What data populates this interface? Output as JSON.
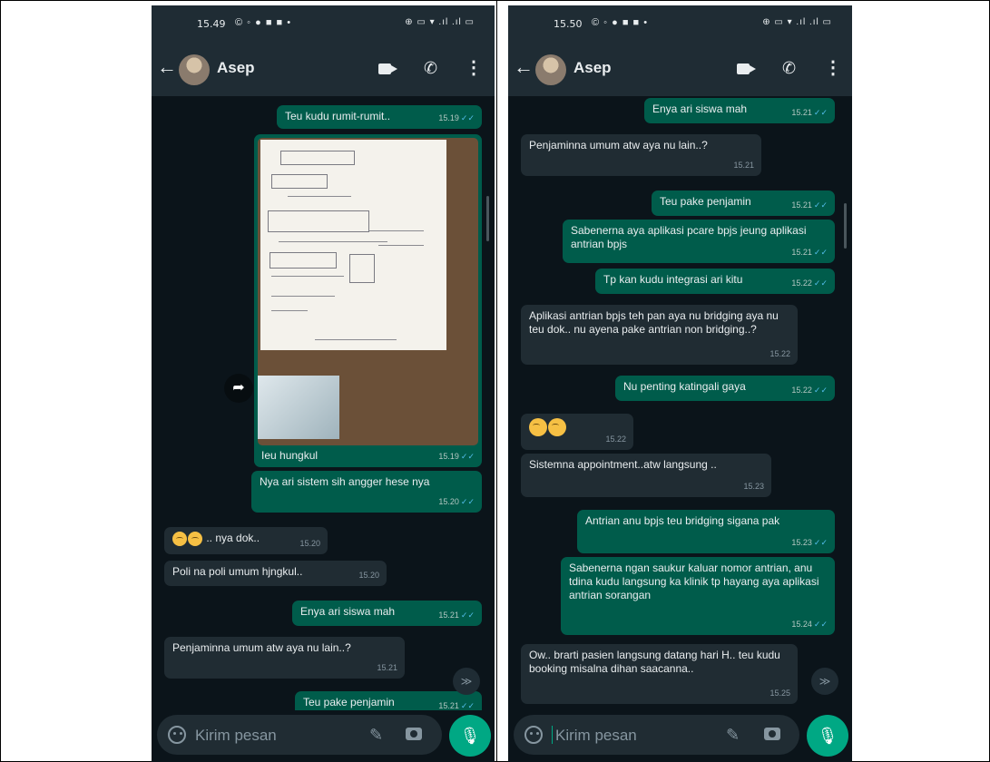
{
  "left": {
    "status": {
      "time": "15.49",
      "notif_icons": "© ◦ ● ■ ■ •",
      "sys_icons": "⊕ ▭ ▾ .ıl .ıl ▭"
    },
    "appbar": {
      "name": "Asep",
      "back": "←",
      "phone": "✆",
      "menu": "⋮"
    },
    "messages": [
      {
        "text": "Teu kudu rumit-rumit..",
        "time": "15.19",
        "tick": "✓✓"
      },
      {
        "caption": "Ieu hungkul",
        "time": "15.19",
        "tick": "✓✓"
      },
      {
        "text": "Nya ari sistem sih angger hese nya",
        "time": "15.20",
        "tick": "✓✓"
      },
      {
        "text": ".. nya dok..",
        "time": "15.20"
      },
      {
        "text": "Poli na poli umum hjngkul..",
        "time": "15.20"
      },
      {
        "text": "Enya ari siswa mah",
        "time": "15.21",
        "tick": "✓✓"
      },
      {
        "text": "Penjaminna umum atw aya nu lain..?",
        "time": "15.21"
      },
      {
        "text": "Teu pake penjamin",
        "time": "15.21",
        "tick": "✓✓"
      }
    ],
    "forward": "➦",
    "scroll_down": "≫",
    "input_placeholder": "Kirim pesan",
    "attach": "✎",
    "mic": "🎙"
  },
  "right": {
    "status": {
      "time": "15.50",
      "notif_icons": "© ◦ ● ■ ■ •",
      "sys_icons": "⊕ ▭ ▾ .ıl .ıl ▭"
    },
    "appbar": {
      "name": "Asep",
      "back": "←",
      "phone": "✆",
      "menu": "⋮"
    },
    "messages": [
      {
        "text": "Enya ari siswa mah",
        "time": "15.21",
        "tick": "✓✓"
      },
      {
        "text": "Penjaminna umum atw aya nu lain..?",
        "time": "15.21"
      },
      {
        "text": "Teu pake penjamin",
        "time": "15.21",
        "tick": "✓✓"
      },
      {
        "text": "Sabenerna aya aplikasi pcare bpjs jeung aplikasi antrian bpjs",
        "time": "15.21",
        "tick": "✓✓"
      },
      {
        "text": "Tp kan kudu integrasi ari kitu",
        "time": "15.22",
        "tick": "✓✓"
      },
      {
        "text": "Aplikasi antrian bpjs teh pan aya nu bridging aya nu teu dok.. nu ayena pake antrian non bridging..?",
        "time": "15.22"
      },
      {
        "text": "Nu penting katingali gaya",
        "time": "15.22",
        "tick": "✓✓"
      },
      {
        "text": "",
        "time": "15.22"
      },
      {
        "text": "Sistemna appointment..atw langsung ..",
        "time": "15.23"
      },
      {
        "text": "Antrian anu bpjs teu bridging sigana pak",
        "time": "15.23",
        "tick": "✓✓"
      },
      {
        "text": "Sabenerna ngan saukur kaluar nomor antrian, anu tdina kudu langsung ka klinik tp hayang aya aplikasi antrian sorangan",
        "time": "15.24",
        "tick": "✓✓"
      },
      {
        "text": "Ow.. brarti pasien langsung datang hari H.. teu kudu booking misalna dihan saacanna..",
        "time": "15.25"
      }
    ],
    "scroll_down": "≫",
    "input_placeholder": "Kirim pesan",
    "attach": "✎",
    "mic": "🎙"
  }
}
